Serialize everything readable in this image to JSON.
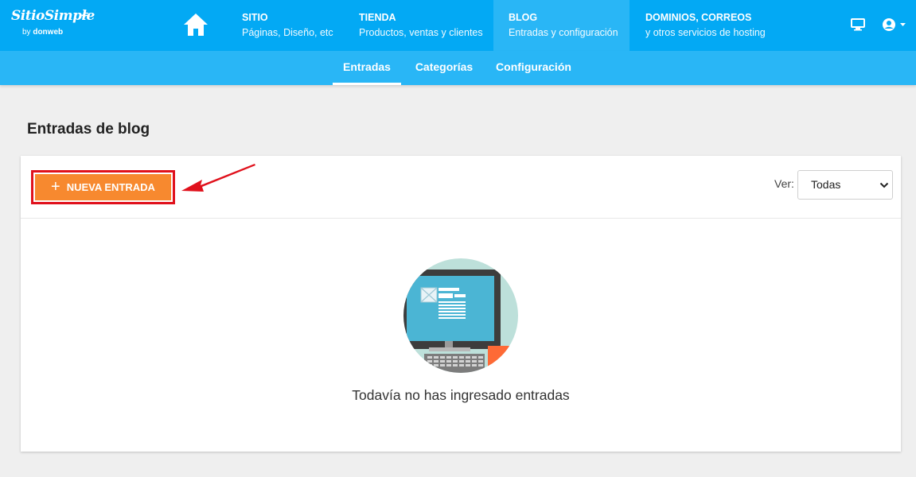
{
  "brand": {
    "name": "SitioSimple",
    "by": "by",
    "by_brand": "donweb"
  },
  "nav": [
    {
      "title": "SITIO",
      "subtitle": "Páginas, Diseño, etc"
    },
    {
      "title": "TIENDA",
      "subtitle": "Productos, ventas y clientes"
    },
    {
      "title": "BLOG",
      "subtitle": "Entradas y configuración"
    },
    {
      "title": "DOMINIOS, CORREOS",
      "subtitle": "y otros servicios de hosting"
    }
  ],
  "subnav": [
    {
      "label": "Entradas"
    },
    {
      "label": "Categorías"
    },
    {
      "label": "Configuración"
    }
  ],
  "page": {
    "title": "Entradas de blog",
    "new_button": "NUEVA ENTRADA",
    "ver_label": "Ver:",
    "ver_value": "Todas",
    "empty_message": "Todavía no has ingresado entradas"
  },
  "colors": {
    "topbar": "#03a9f4",
    "subbar": "#29b6f6",
    "accent_button": "#f7892f",
    "highlight": "#e0111c"
  }
}
